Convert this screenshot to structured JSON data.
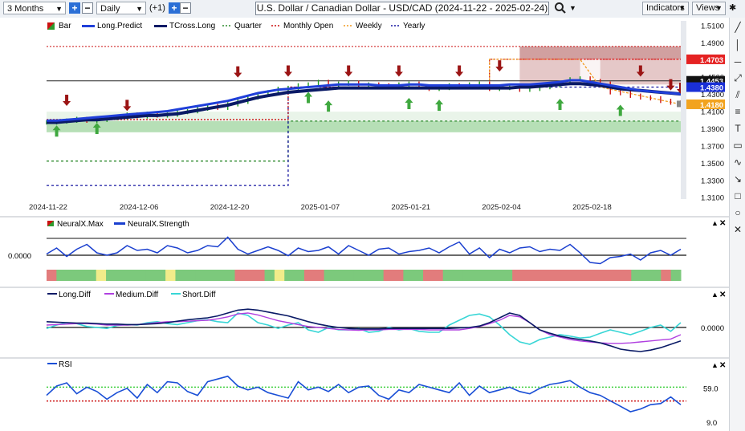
{
  "toolbar": {
    "period": "3 Months",
    "interval": "Daily",
    "interval_step": "(+1)",
    "title": "U.S. Dollar / Canadian Dollar - USD/CAD (2024-11-22 - 2025-02-24)",
    "indicators_label": "Indicators",
    "views_label": "Views"
  },
  "colors": {
    "long_predict": "#1f3fd9",
    "tcross_long": "#0a1a66",
    "quarter": "#2e8b2e",
    "monthly_open": "#cc1111",
    "weekly": "#f29a1e",
    "yearly": "#1515a0",
    "green_zone": "#9ed49e",
    "red_zone": "#c98f8f",
    "neural_max": "#1a3fcf",
    "long_diff": "#0a1a66",
    "medium_diff": "#b040e0",
    "short_diff": "#38d6d6",
    "rsi": "#1a4fd6"
  },
  "chart_data": [
    {
      "type": "line",
      "panel": "price",
      "legend": [
        "Bar",
        "Long.Predict",
        "TCross.Long",
        "Quarter",
        "Monthly Open",
        "Weekly",
        "Yearly"
      ],
      "x_ticks": [
        "2024-11-22",
        "2024-12-06",
        "2024-12-20",
        "2025-01-07",
        "2025-01-21",
        "2025-02-04",
        "2025-02-18"
      ],
      "y_ticks": [
        1.51,
        1.49,
        1.47,
        1.45,
        1.43,
        1.41,
        1.39,
        1.37,
        1.35,
        1.33,
        1.31
      ],
      "y_tick_labels": [
        "1.5100",
        "1.4900",
        "1.4700",
        "1.4500",
        "1.4300",
        "1.4100",
        "1.3900",
        "1.3700",
        "1.3500",
        "1.3300",
        "1.3100"
      ],
      "ylim": [
        1.306,
        1.515
      ],
      "x_count": 64,
      "price_labels": [
        {
          "text": "1.4703",
          "value": 1.4703,
          "color": "#e52222"
        },
        {
          "text": "1.4453",
          "value": 1.4453,
          "color": "#111111"
        },
        {
          "text": "1.4380",
          "value": 1.438,
          "color": "#1a2fd6"
        },
        {
          "text": "1.4180",
          "value": 1.418,
          "color": "#f2a31e"
        }
      ],
      "close": [
        1.397,
        1.398,
        1.399,
        1.401,
        1.399,
        1.4,
        1.402,
        1.403,
        1.406,
        1.404,
        1.407,
        1.405,
        1.406,
        1.409,
        1.41,
        1.413,
        1.416,
        1.414,
        1.418,
        1.421,
        1.426,
        1.429,
        1.432,
        1.436,
        1.437,
        1.44,
        1.441,
        1.444,
        1.441,
        1.442,
        1.443,
        1.44,
        1.441,
        1.44,
        1.439,
        1.441,
        1.442,
        1.438,
        1.436,
        1.437,
        1.44,
        1.439,
        1.441,
        1.442,
        1.436,
        1.437,
        1.438,
        1.435,
        1.436,
        1.438,
        1.44,
        1.443,
        1.447,
        1.448,
        1.445,
        1.442,
        1.432,
        1.431,
        1.428,
        1.426,
        1.425,
        1.422,
        1.42,
        1.418
      ],
      "long_predict": [
        1.399,
        1.399,
        1.4,
        1.401,
        1.402,
        1.403,
        1.404,
        1.405,
        1.406,
        1.407,
        1.408,
        1.409,
        1.41,
        1.412,
        1.414,
        1.416,
        1.418,
        1.42,
        1.422,
        1.425,
        1.428,
        1.431,
        1.433,
        1.435,
        1.436,
        1.437,
        1.438,
        1.439,
        1.44,
        1.441,
        1.441,
        1.441,
        1.441,
        1.44,
        1.44,
        1.44,
        1.441,
        1.441,
        1.44,
        1.44,
        1.44,
        1.44,
        1.44,
        1.44,
        1.44,
        1.44,
        1.441,
        1.441,
        1.441,
        1.442,
        1.443,
        1.444,
        1.446,
        1.446,
        1.444,
        1.442,
        1.44,
        1.438,
        1.436,
        1.434,
        1.433,
        1.432,
        1.431,
        1.43
      ],
      "tcross_long": [
        1.397,
        1.397,
        1.398,
        1.399,
        1.4,
        1.4,
        1.401,
        1.402,
        1.403,
        1.404,
        1.405,
        1.405,
        1.406,
        1.407,
        1.409,
        1.411,
        1.413,
        1.415,
        1.417,
        1.42,
        1.423,
        1.426,
        1.428,
        1.43,
        1.432,
        1.433,
        1.434,
        1.435,
        1.436,
        1.437,
        1.437,
        1.437,
        1.437,
        1.437,
        1.437,
        1.437,
        1.437,
        1.437,
        1.437,
        1.437,
        1.437,
        1.437,
        1.437,
        1.437,
        1.437,
        1.437,
        1.437,
        1.438,
        1.438,
        1.439,
        1.44,
        1.441,
        1.442,
        1.442,
        1.441,
        1.44,
        1.438,
        1.436,
        1.435,
        1.434,
        1.433,
        1.432,
        1.431,
        1.43
      ],
      "quarter_level": [
        {
          "from": 0,
          "to": 24,
          "value": 1.352
        },
        {
          "from": 24,
          "to": 63,
          "value": 1.3985
        }
      ],
      "monthly_open": [
        {
          "from": 0,
          "to": 24,
          "value": 1.4003
        },
        {
          "from": 24,
          "to": 44,
          "value": 1.438
        },
        {
          "from": 44,
          "to": 63,
          "value": 1.4703
        }
      ],
      "yearly": [
        {
          "from": 0,
          "to": 24,
          "value": 1.3236
        },
        {
          "from": 24,
          "to": 63,
          "value": 1.438
        }
      ],
      "down_arrows": [
        2,
        8,
        17,
        22,
        26,
        31,
        38,
        43,
        59,
        66,
        73,
        78
      ],
      "up_arrows": [
        1,
        4,
        24,
        25,
        33,
        38,
        45,
        63,
        72,
        75
      ]
    },
    {
      "type": "line",
      "panel": "neuralx",
      "legend": [
        "NeuralX.Max",
        "NeuralX.Strength"
      ],
      "y_tick_labels": [
        "0.0000"
      ],
      "ylim": [
        -1,
        1
      ],
      "strength": [
        0.05,
        0.3,
        -0.05,
        0.25,
        0.45,
        0.1,
        0.0,
        0.1,
        0.4,
        0.2,
        0.25,
        0.1,
        0.4,
        0.3,
        0.1,
        0.2,
        0.4,
        0.35,
        0.75,
        0.25,
        0.05,
        0.2,
        0.35,
        0.2,
        -0.02,
        0.3,
        0.15,
        0.2,
        0.35,
        0.05,
        0.4,
        0.2,
        0.0,
        0.25,
        0.3,
        0.05,
        0.15,
        0.2,
        0.3,
        0.1,
        0.35,
        0.55,
        0.05,
        0.3,
        -0.1,
        0.25,
        0.1,
        0.3,
        0.35,
        0.15,
        0.25,
        0.2,
        0.45,
        0.1,
        -0.3,
        -0.35,
        -0.1,
        -0.05,
        0.05,
        -0.2,
        0.1,
        0.2,
        0.0,
        0.25
      ],
      "max_bar_colors": [
        "R",
        "G",
        "G",
        "G",
        "G",
        "Y",
        "G",
        "G",
        "G",
        "G",
        "G",
        "G",
        "Y",
        "G",
        "G",
        "G",
        "G",
        "G",
        "G",
        "R",
        "R",
        "R",
        "G",
        "Y",
        "G",
        "G",
        "R",
        "R",
        "G",
        "G",
        "G",
        "G",
        "G",
        "G",
        "R",
        "R",
        "G",
        "G",
        "R",
        "R",
        "G",
        "G",
        "G",
        "G",
        "G",
        "G",
        "G",
        "R",
        "R",
        "R",
        "R",
        "R",
        "R",
        "R",
        "R",
        "R",
        "R",
        "R",
        "R",
        "G",
        "G",
        "G",
        "R",
        "G"
      ]
    },
    {
      "type": "line",
      "panel": "diff",
      "legend": [
        "Long.Diff",
        "Medium.Diff",
        "Short.Diff"
      ],
      "y_tick_labels": [
        "0.0000"
      ],
      "ylim": [
        -1,
        1
      ],
      "long_diff": [
        0.12,
        0.11,
        0.1,
        0.09,
        0.09,
        0.08,
        0.07,
        0.07,
        0.06,
        0.06,
        0.07,
        0.08,
        0.1,
        0.13,
        0.16,
        0.18,
        0.2,
        0.24,
        0.3,
        0.36,
        0.38,
        0.36,
        0.32,
        0.28,
        0.24,
        0.18,
        0.12,
        0.07,
        0.03,
        0.0,
        -0.02,
        -0.03,
        -0.03,
        -0.03,
        -0.02,
        -0.02,
        -0.02,
        -0.02,
        -0.02,
        -0.02,
        -0.02,
        -0.01,
        0.0,
        0.03,
        0.1,
        0.2,
        0.3,
        0.25,
        0.1,
        -0.05,
        -0.12,
        -0.18,
        -0.22,
        -0.25,
        -0.28,
        -0.32,
        -0.38,
        -0.45,
        -0.48,
        -0.5,
        -0.47,
        -0.42,
        -0.35,
        -0.28
      ],
      "medium_diff": [
        0.05,
        0.06,
        0.07,
        0.08,
        0.08,
        0.07,
        0.05,
        0.05,
        0.05,
        0.06,
        0.08,
        0.1,
        0.12,
        0.12,
        0.13,
        0.14,
        0.15,
        0.18,
        0.22,
        0.28,
        0.3,
        0.26,
        0.2,
        0.14,
        0.1,
        0.06,
        0.02,
        0.0,
        -0.02,
        -0.04,
        -0.05,
        -0.06,
        -0.05,
        -0.05,
        -0.04,
        -0.04,
        -0.04,
        -0.04,
        -0.05,
        -0.05,
        -0.05,
        -0.05,
        -0.02,
        0.02,
        0.08,
        0.15,
        0.25,
        0.22,
        0.1,
        -0.05,
        -0.15,
        -0.2,
        -0.25,
        -0.28,
        -0.3,
        -0.32,
        -0.33,
        -0.33,
        -0.32,
        -0.3,
        -0.28,
        -0.26,
        -0.24,
        -0.15
      ],
      "short_diff": [
        -0.02,
        0.05,
        0.1,
        0.08,
        0.02,
        0.0,
        -0.02,
        0.04,
        0.06,
        0.05,
        0.1,
        0.12,
        0.08,
        0.06,
        0.1,
        0.14,
        0.16,
        0.12,
        0.1,
        0.3,
        0.25,
        0.1,
        0.05,
        -0.02,
        0.05,
        0.1,
        -0.05,
        -0.1,
        0.0,
        -0.05,
        -0.05,
        -0.02,
        -0.1,
        -0.08,
        0.0,
        -0.05,
        -0.02,
        -0.08,
        -0.1,
        -0.1,
        0.05,
        0.15,
        0.25,
        0.28,
        0.22,
        0.05,
        -0.15,
        -0.3,
        -0.35,
        -0.25,
        -0.2,
        -0.15,
        -0.18,
        -0.22,
        -0.2,
        -0.12,
        -0.05,
        -0.1,
        -0.15,
        -0.08,
        0.0,
        0.05,
        -0.08,
        0.1
      ]
    },
    {
      "type": "line",
      "panel": "rsi",
      "legend": [
        "RSI"
      ],
      "y_tick_labels": [
        "59.0",
        "9.0"
      ],
      "ylim": [
        0,
        100
      ],
      "upper_level": 70,
      "lower_level": 30,
      "rsi": [
        55,
        72,
        78,
        58,
        70,
        62,
        48,
        60,
        68,
        50,
        75,
        60,
        80,
        78,
        62,
        55,
        80,
        85,
        90,
        72,
        65,
        70,
        60,
        55,
        50,
        80,
        65,
        70,
        62,
        75,
        60,
        70,
        72,
        55,
        48,
        65,
        60,
        75,
        70,
        65,
        60,
        78,
        55,
        72,
        60,
        65,
        70,
        62,
        58,
        68,
        75,
        78,
        82,
        70,
        60,
        55,
        45,
        35,
        25,
        30,
        38,
        40,
        52,
        38
      ]
    }
  ]
}
